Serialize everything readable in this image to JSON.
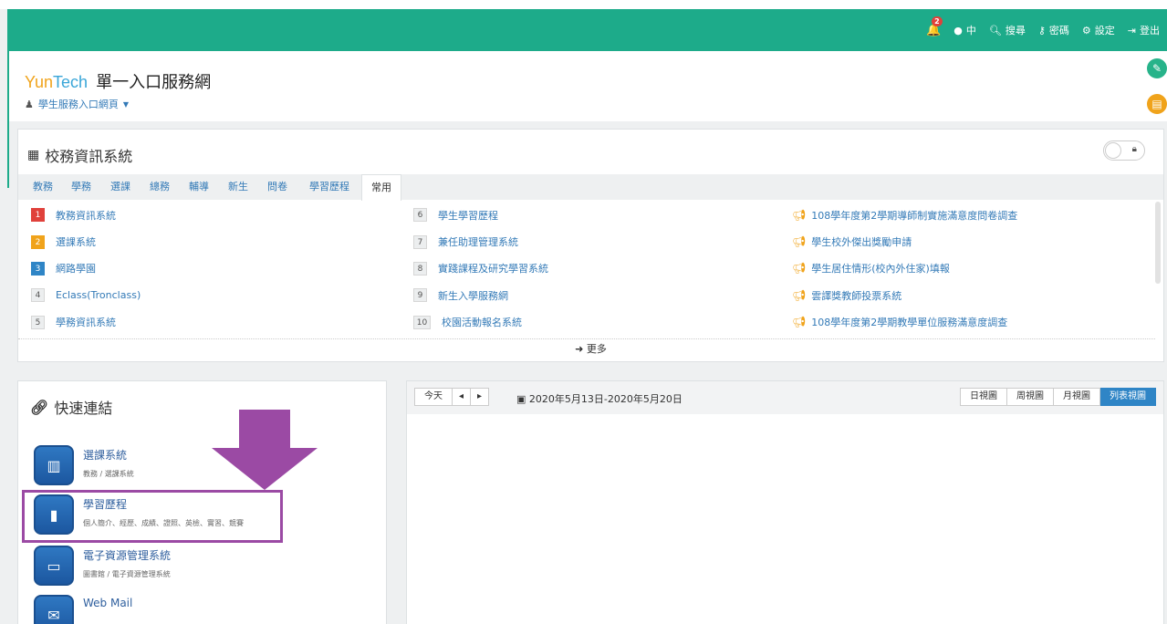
{
  "navbar": {
    "notification_count": "2",
    "lang_label": "中",
    "search_label": "搜尋",
    "password_label": "密碼",
    "settings_label": "設定",
    "logout_label": "登出"
  },
  "header": {
    "brand_yun": "Yun",
    "brand_tech": "Tech",
    "brand_title": "單一入口服務網",
    "sub_link": "學生服務入口網頁"
  },
  "system_panel": {
    "title": "校務資訊系統",
    "tabs": [
      "教務",
      "學務",
      "選課",
      "總務",
      "輔導",
      "新生",
      "問卷",
      "學習歷程",
      "常用"
    ],
    "active_tab": "常用",
    "column1": [
      {
        "num": "1",
        "label": "教務資訊系統"
      },
      {
        "num": "2",
        "label": "選課系統"
      },
      {
        "num": "3",
        "label": "網路學園"
      },
      {
        "num": "4",
        "label": "Eclass(Tronclass)"
      },
      {
        "num": "5",
        "label": "學務資訊系統"
      }
    ],
    "column2": [
      {
        "num": "6",
        "label": "學生學習歷程"
      },
      {
        "num": "7",
        "label": "兼任助理管理系統"
      },
      {
        "num": "8",
        "label": "實踐課程及研究學習系統"
      },
      {
        "num": "9",
        "label": "新生入學服務網"
      },
      {
        "num": "10",
        "label": "校園活動報名系統"
      }
    ],
    "announcements": [
      "108學年度第2學期導師制實施滿意度問卷調查",
      "學生校外傑出獎勵申請",
      "學生居住情形(校內外住家)填報",
      "雲譯獎教師投票系統",
      "108學年度第2學期教學單位服務滿意度調查"
    ],
    "more_label": "更多"
  },
  "quick_links": {
    "title": "快速連結",
    "items": [
      {
        "name": "選課系統",
        "desc": "教務 / 選課系統"
      },
      {
        "name": "學習歷程",
        "desc": "個人簡介、經歷、成績、證照、英檢、實習、競賽"
      },
      {
        "name": "電子資源管理系統",
        "desc": "圖書館 / 電子資源管理系統"
      },
      {
        "name": "Web Mail",
        "desc": ""
      }
    ]
  },
  "calendar": {
    "today_label": "今天",
    "prev_label": "◂",
    "next_label": "▸",
    "date_range": "2020年5月13日-2020年5月20日",
    "views": [
      "日視圖",
      "周視圖",
      "月視圖",
      "列表視圖"
    ],
    "active_view": "列表視圖"
  },
  "colors": {
    "navbar": "#1dab8a",
    "link": "#337ab7",
    "accent_orange": "#f0a31b",
    "highlight": "#9b4aa4"
  }
}
